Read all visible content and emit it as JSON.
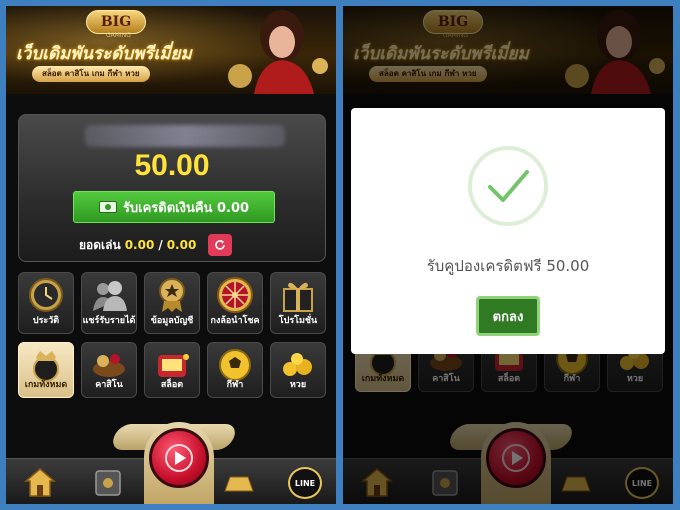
{
  "colors": {
    "balance": "#ffe23a",
    "cashback_button": "#2f9a22",
    "refresh_button": "#e23b59",
    "ok_button": "#2f7a22",
    "check_mark": "#74c26a",
    "frame_background": "#3d7fbf"
  },
  "banner": {
    "logo": "BIG",
    "logo_sub": "GAMING",
    "headline": "เว็บเดิมพันระดับพรีเมี่ยม",
    "subline": "สล็อต คาสิโน เกม กีฬา หวย"
  },
  "card": {
    "balance": "50.00",
    "cashback_label": "รับเครดิตเงินคืน 0.00",
    "turnover_label": "ยอดเล่น",
    "turnover_current": "0.00",
    "turnover_separator": "/",
    "turnover_target": "0.00"
  },
  "menu": {
    "row1": [
      {
        "label": "ประวัติ",
        "icon": "clock-icon"
      },
      {
        "label": "แชร์รับรายได้",
        "icon": "users-icon"
      },
      {
        "label": "ข้อมูลบัญชี",
        "icon": "badge-icon"
      },
      {
        "label": "กงล้อนำโชค",
        "icon": "wheel-icon"
      },
      {
        "label": "โปรโมชั่น",
        "icon": "gift-icon"
      }
    ],
    "row2": [
      {
        "label": "เกมทั้งหมด",
        "icon": "crown-chip-icon"
      },
      {
        "label": "คาสิโน",
        "icon": "casino-icon"
      },
      {
        "label": "สล็อต",
        "icon": "slot-icon"
      },
      {
        "label": "กีฬา",
        "icon": "soccer-ball-icon"
      },
      {
        "label": "หวย",
        "icon": "lottery-icon"
      }
    ]
  },
  "nav": {
    "home_icon": "home-icon",
    "safe_icon": "safe-icon",
    "play_icon": "play-icon",
    "gold_icon": "gold-bar-icon",
    "line_label": "LINE"
  },
  "modal": {
    "icon": "checkmark-icon",
    "message": "รับคูปองเครดิตฟรี 50.00",
    "ok_label": "ตกลง"
  }
}
